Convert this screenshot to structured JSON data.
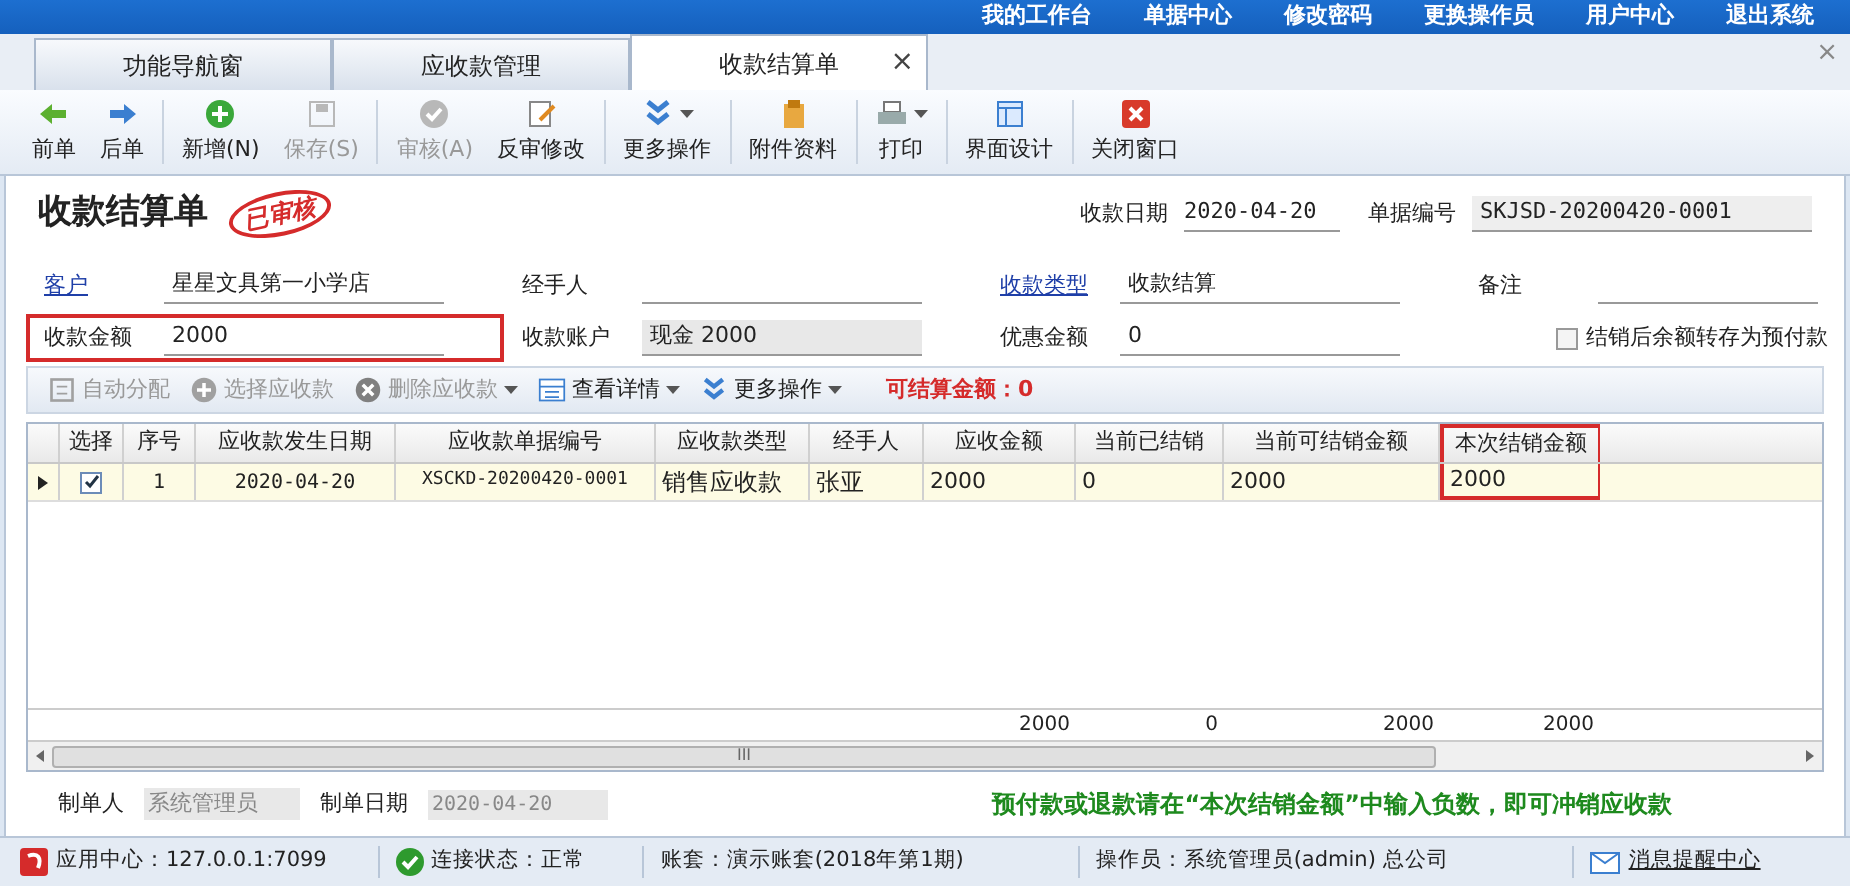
{
  "top_menu": [
    "我的工作台",
    "单据中心",
    "修改密码",
    "更换操作员",
    "用户中心",
    "退出系统"
  ],
  "tabs": [
    {
      "label": "功能导航窗",
      "selected": false
    },
    {
      "label": "应收款管理",
      "selected": false
    },
    {
      "label": "收款结算单",
      "selected": true,
      "close": "×"
    }
  ],
  "close_all": "×",
  "toolbar": [
    {
      "label": "前单",
      "disabled": false,
      "dropdown": false
    },
    {
      "label": "后单",
      "disabled": false,
      "dropdown": false
    },
    {
      "label": "新增(N)",
      "disabled": false,
      "dropdown": false
    },
    {
      "label": "保存(S)",
      "disabled": true,
      "dropdown": false
    },
    {
      "label": "审核(A)",
      "disabled": true,
      "dropdown": false
    },
    {
      "label": "反审修改",
      "disabled": false,
      "dropdown": false
    },
    {
      "label": "更多操作",
      "disabled": false,
      "dropdown": true
    },
    {
      "label": "附件资料",
      "disabled": false,
      "dropdown": false
    },
    {
      "label": "打印",
      "disabled": false,
      "dropdown": true
    },
    {
      "label": "界面设计",
      "disabled": false,
      "dropdown": false
    },
    {
      "label": "关闭窗口",
      "disabled": false,
      "dropdown": false
    }
  ],
  "document": {
    "title": "收款结算单",
    "stamp": "已审核",
    "date_label": "收款日期",
    "date": "2020-04-20",
    "number_label": "单据编号",
    "number": "SKJSD-20200420-0001"
  },
  "form_rows": [
    [
      {
        "label": "客户",
        "value": "星星文具第一小学店",
        "link": true,
        "highlighted": false,
        "readonly": false
      },
      {
        "label": "经手人",
        "link": false,
        "highlighted": false,
        "readonly": false
      },
      {
        "label": "收款类型",
        "value": "收款结算",
        "link": true,
        "highlighted": false,
        "readonly": false
      },
      {
        "label": "备注",
        "link": false,
        "highlighted": false,
        "readonly": false
      }
    ],
    [
      {
        "label": "收款金额",
        "value": "2000",
        "link": false,
        "highlighted": true,
        "readonly": false
      },
      {
        "label": "收款账户",
        "value": "现金 2000",
        "link": false,
        "highlighted": false,
        "readonly": true
      },
      {
        "label": "优惠金额",
        "value": "0",
        "link": false,
        "highlighted": false,
        "readonly": false
      }
    ]
  ],
  "balance_checkbox": {
    "label": "结销后余额转存为预付款",
    "checked": false
  },
  "grid_toolbar": [
    {
      "label": "自动分配",
      "disabled": true,
      "dropdown": false
    },
    {
      "label": "选择应收款",
      "disabled": true,
      "dropdown": false
    },
    {
      "label": "删除应收款",
      "disabled": true,
      "dropdown": true
    },
    {
      "label": "查看详情",
      "disabled": false,
      "dropdown": true
    },
    {
      "label": "更多操作",
      "disabled": false,
      "dropdown": true
    }
  ],
  "available_amount": "可结算金额：0",
  "grid": {
    "columns": [
      {
        "label": "选择",
        "highlighted": false
      },
      {
        "label": "序号",
        "highlighted": false
      },
      {
        "label": "应收款发生日期",
        "highlighted": false
      },
      {
        "label": "应收款单据编号",
        "highlighted": false
      },
      {
        "label": "应收款类型",
        "highlighted": false
      },
      {
        "label": "经手人",
        "highlighted": false
      },
      {
        "label": "应收金额",
        "highlighted": false
      },
      {
        "label": "当前已结销",
        "highlighted": false
      },
      {
        "label": "当前可结销金额",
        "highlighted": false
      },
      {
        "label": "本次结销金额",
        "highlighted": true
      }
    ],
    "rows": [
      {
        "current": true,
        "checked": true,
        "cells": [
          "",
          "1",
          "2020-04-20",
          "XSCKD-20200420-0001",
          "销售应收款",
          "张亚",
          "2000",
          "0",
          "2000",
          "2000"
        ]
      }
    ],
    "totals": [
      "2000",
      "0",
      "2000",
      "2000"
    ],
    "scroll_grip": "III"
  },
  "footer": [
    {
      "label": "制单人",
      "value": "系统管理员"
    },
    {
      "label": "制单日期",
      "value": "2020-04-20"
    }
  ],
  "note": "预付款或退款请在“本次结销金额”中输入负数，即可冲销应收款",
  "status_bar": [
    {
      "kind": "app",
      "text": "应用中心：127.0.0.1:7099"
    },
    {
      "kind": "connection",
      "text": "连接状态：正常"
    },
    {
      "kind": "plain",
      "text": "账套：演示账套(2018年第1期)"
    },
    {
      "kind": "plain",
      "text": "操作员：系统管理员(admin) 总公司"
    },
    {
      "kind": "message",
      "text": "消息提醒中心"
    }
  ]
}
